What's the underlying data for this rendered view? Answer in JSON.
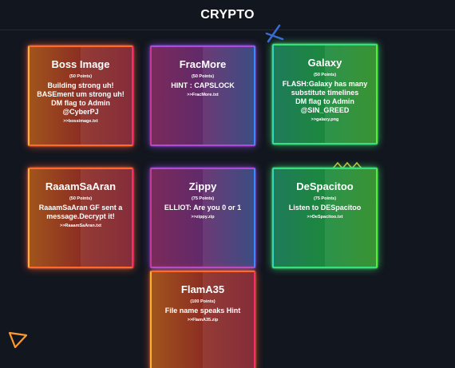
{
  "header": {
    "title": "CRYPTO"
  },
  "challenges": [
    {
      "name": "Boss Image",
      "points": "(50 Points)",
      "desc_lines": [
        "Building strong uh!",
        "BASEment um strong uh!",
        "DM flag to Admin",
        "@CyberPJ"
      ],
      "file": ">>bossimage.txt",
      "theme": "orange"
    },
    {
      "name": "FracMore",
      "points": "(50 Points)",
      "desc_lines": [
        "HINT : CAPSLOCK"
      ],
      "file": ">>FracMore.txt",
      "theme": "purple"
    },
    {
      "name": "Galaxy",
      "points": "(50 Points)",
      "desc_lines": [
        "FLASH:Galaxy has many",
        "substitute timelines",
        "DM flag to Admin",
        "@SIN_GREED"
      ],
      "file": ">>galaxy.png",
      "theme": "green"
    },
    {
      "name": "RaaamSaAran",
      "points": "(50 Points)",
      "desc_lines": [
        "RaaamSaAran GF sent a",
        "message.Decrypt it!"
      ],
      "file": ">>RaaamSaAran.txt",
      "theme": "orange"
    },
    {
      "name": "Zippy",
      "points": "(75 Points)",
      "desc_lines": [
        "ELLIOT: Are you 0 or 1"
      ],
      "file": ">>zippy.zip",
      "theme": "purple"
    },
    {
      "name": "DeSpacitoo",
      "points": "(75 Points)",
      "desc_lines": [
        "Listen to DESpacitoo"
      ],
      "file": ">>DeSpacitoo.txt",
      "theme": "green"
    },
    {
      "name": "FlamA35",
      "points": "(100 Points)",
      "desc_lines": [
        "File name speaks Hint"
      ],
      "file": ">>FlamA35.zip",
      "theme": "orange"
    }
  ],
  "decor_colors": {
    "blue": "#3a6ad8",
    "orange": "#ff9a2a",
    "yellow": "#d8c028"
  }
}
